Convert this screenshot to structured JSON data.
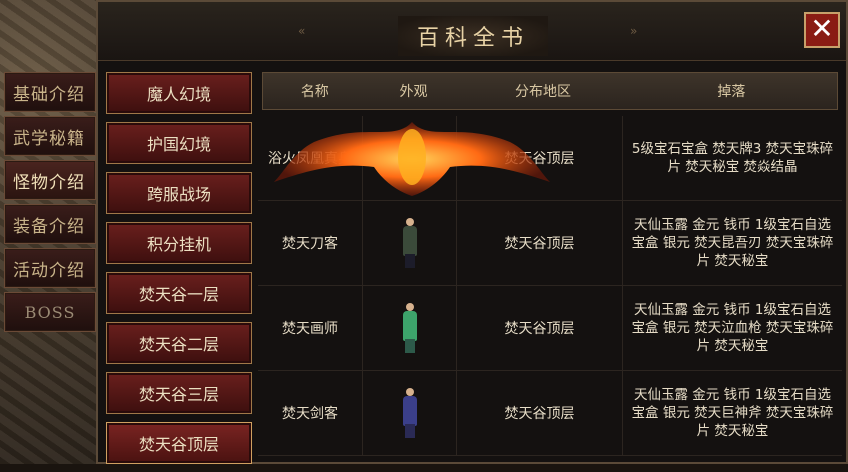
{
  "side_tabs": [
    "基础介绍",
    "武学秘籍",
    "怪物介绍",
    "装备介绍",
    "活动介绍",
    "BOSS"
  ],
  "title": "百科全书",
  "close_icon": "close-icon",
  "categories": [
    "魔人幻境",
    "护国幻境",
    "跨服战场",
    "积分挂机",
    "焚天谷一层",
    "焚天谷二层",
    "焚天谷三层",
    "焚天谷顶层"
  ],
  "active_category": "焚天谷顶层",
  "table": {
    "headers": [
      "名称",
      "外观",
      "分布地区",
      "掉落"
    ],
    "rows": [
      {
        "name": "浴火凤凰真身",
        "area": "焚天谷顶层",
        "drops": "5级宝石宝盒 焚天牌3 焚天宝珠碎片 焚天秘宝 焚焱结晶",
        "look": "fire-phoenix"
      },
      {
        "name": "焚天刀客",
        "area": "焚天谷顶层",
        "drops": "天仙玉露 金元 钱币 1级宝石自选宝盒 银元 焚天昆吾刃 焚天宝珠碎片 焚天秘宝",
        "look": "saber-warrior"
      },
      {
        "name": "焚天画师",
        "area": "焚天谷顶层",
        "drops": "天仙玉露 金元 钱币 1级宝石自选宝盒 银元 焚天泣血枪 焚天宝珠碎片 焚天秘宝",
        "look": "painter"
      },
      {
        "name": "焚天剑客",
        "area": "焚天谷顶层",
        "drops": "天仙玉露 金元 钱币 1级宝石自选宝盒 银元 焚天巨神斧 焚天宝珠碎片 焚天秘宝",
        "look": "swordsman"
      }
    ]
  },
  "colors": {
    "accent_red": "#6a1f1d",
    "gold_border": "#a07848",
    "text_light": "#e6dcc6"
  }
}
